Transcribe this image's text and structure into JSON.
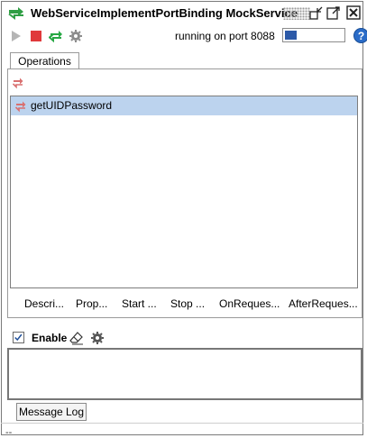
{
  "window": {
    "title": "WebServiceImplementPortBinding MockService",
    "icons": [
      "mockservice-icon",
      "minimize-icon",
      "maximize-icon",
      "close-icon"
    ]
  },
  "toolbar": {
    "icons": [
      "run-icon",
      "stop-icon",
      "restart-icon",
      "settings-icon",
      "help-icon"
    ],
    "status_text": "running on port 8088",
    "help_label": "?",
    "progress_fraction": 0.2
  },
  "tabs": [
    {
      "label": "Operations",
      "selected": true
    }
  ],
  "operations": {
    "items": [
      {
        "label": "getUIDPassword",
        "selected": true
      }
    ],
    "buttons": [
      "Descri...",
      "Prop...",
      "Start ...",
      "Stop ...",
      "OnReques...",
      "AfterReques..."
    ]
  },
  "log": {
    "enable_label": "Enable",
    "enable_checked": true,
    "tab_label": "Message Log",
    "status_text": "--"
  },
  "colors": {
    "selection": "#bcd3ee",
    "stop_red": "#e0393b",
    "accent_green": "#27a844",
    "help_blue": "#2a6cc8",
    "progress_blue": "#2d5aa8"
  }
}
